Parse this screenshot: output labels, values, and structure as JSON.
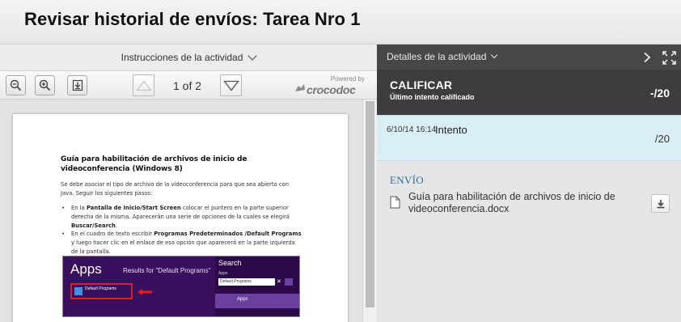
{
  "header": {
    "title": "Revisar historial de envíos: Tarea Nro 1"
  },
  "left": {
    "instructions_label": "Instrucciones de la actividad",
    "toolbar": {
      "zoom_out_icon": "zoom-out-icon",
      "zoom_in_icon": "zoom-in-icon",
      "download_icon": "download-icon",
      "page_indicator": "1 of 2",
      "powered_by": "Powered by",
      "brand": "crocodoc"
    },
    "document": {
      "heading": "Guía para habilitación de archivos de inicio de videoconferencia (Windows 8)",
      "intro": "Se debe asociar el tipo de archivo de la videoconferencia para que sea abierto con Java. Seguir los siguientes pasos:",
      "bullet1_pre": "En la ",
      "bullet1_bold1": "Pantalla de Inicio/Start Screen",
      "bullet1_mid": " colocar el puntero en la parte superior derecha de la misma. Aparecerán una serie de opciones de la cuales se elegirá ",
      "bullet1_bold2": "Buscar/Search",
      "bullet1_end": ".",
      "bullet2_pre": "En el cuadro de texto escribir ",
      "bullet2_bold1": "Programas Predeterminados /Default Programs",
      "bullet2_mid": " y luego hacer clic en el enlace de esa opción que aparecerá en la parte izquierda de la pantalla.",
      "screenshot": {
        "apps_title": "Apps",
        "results_text": "Results for \"Default Programs\"",
        "search_label": "Search",
        "apps_small": "Apps",
        "search_value": "Default Programs",
        "tile_label": "Default Programs",
        "selected_label": "Apps"
      }
    }
  },
  "right": {
    "details_label": "Detalles de la actividad",
    "grade": {
      "title": "CALIFICAR",
      "subtitle": "Último intento calificado",
      "value": "-/20"
    },
    "attempt": {
      "date": "6/10/14 16:14",
      "label": "Intento",
      "value": "/20"
    },
    "submission": {
      "title": "ENVÍO",
      "file_name": "Guía para habilitación de archivos de inicio de videoconferencia.docx"
    }
  },
  "colors": {
    "details_header_bg": "#474747",
    "grade_bg": "#3d3d3d",
    "attempt_bg": "#daeef6",
    "submission_title": "#2a6ea0"
  }
}
